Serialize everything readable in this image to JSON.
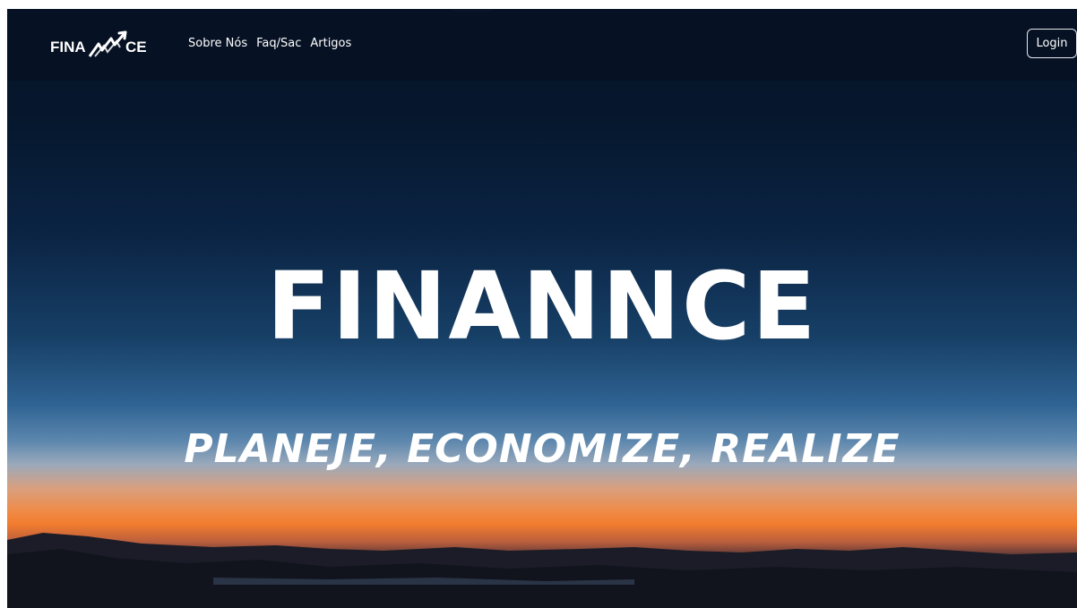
{
  "navbar": {
    "brand": {
      "logo_text": "FINANNCE",
      "logo_icon": "trend-arrow-icon"
    },
    "links": [
      {
        "label": "Sobre Nós"
      },
      {
        "label": "Faq/Sac"
      },
      {
        "label": "Artigos"
      }
    ],
    "login_label": "Login"
  },
  "hero": {
    "title": "FINANNCE",
    "subtitle": "PLANEJE, ECONOMIZE, REALIZE"
  },
  "colors": {
    "navbar_bg": "#071123",
    "sky_top": "#041226",
    "sunset_orange": "#f27c2e",
    "text": "#ffffff"
  }
}
